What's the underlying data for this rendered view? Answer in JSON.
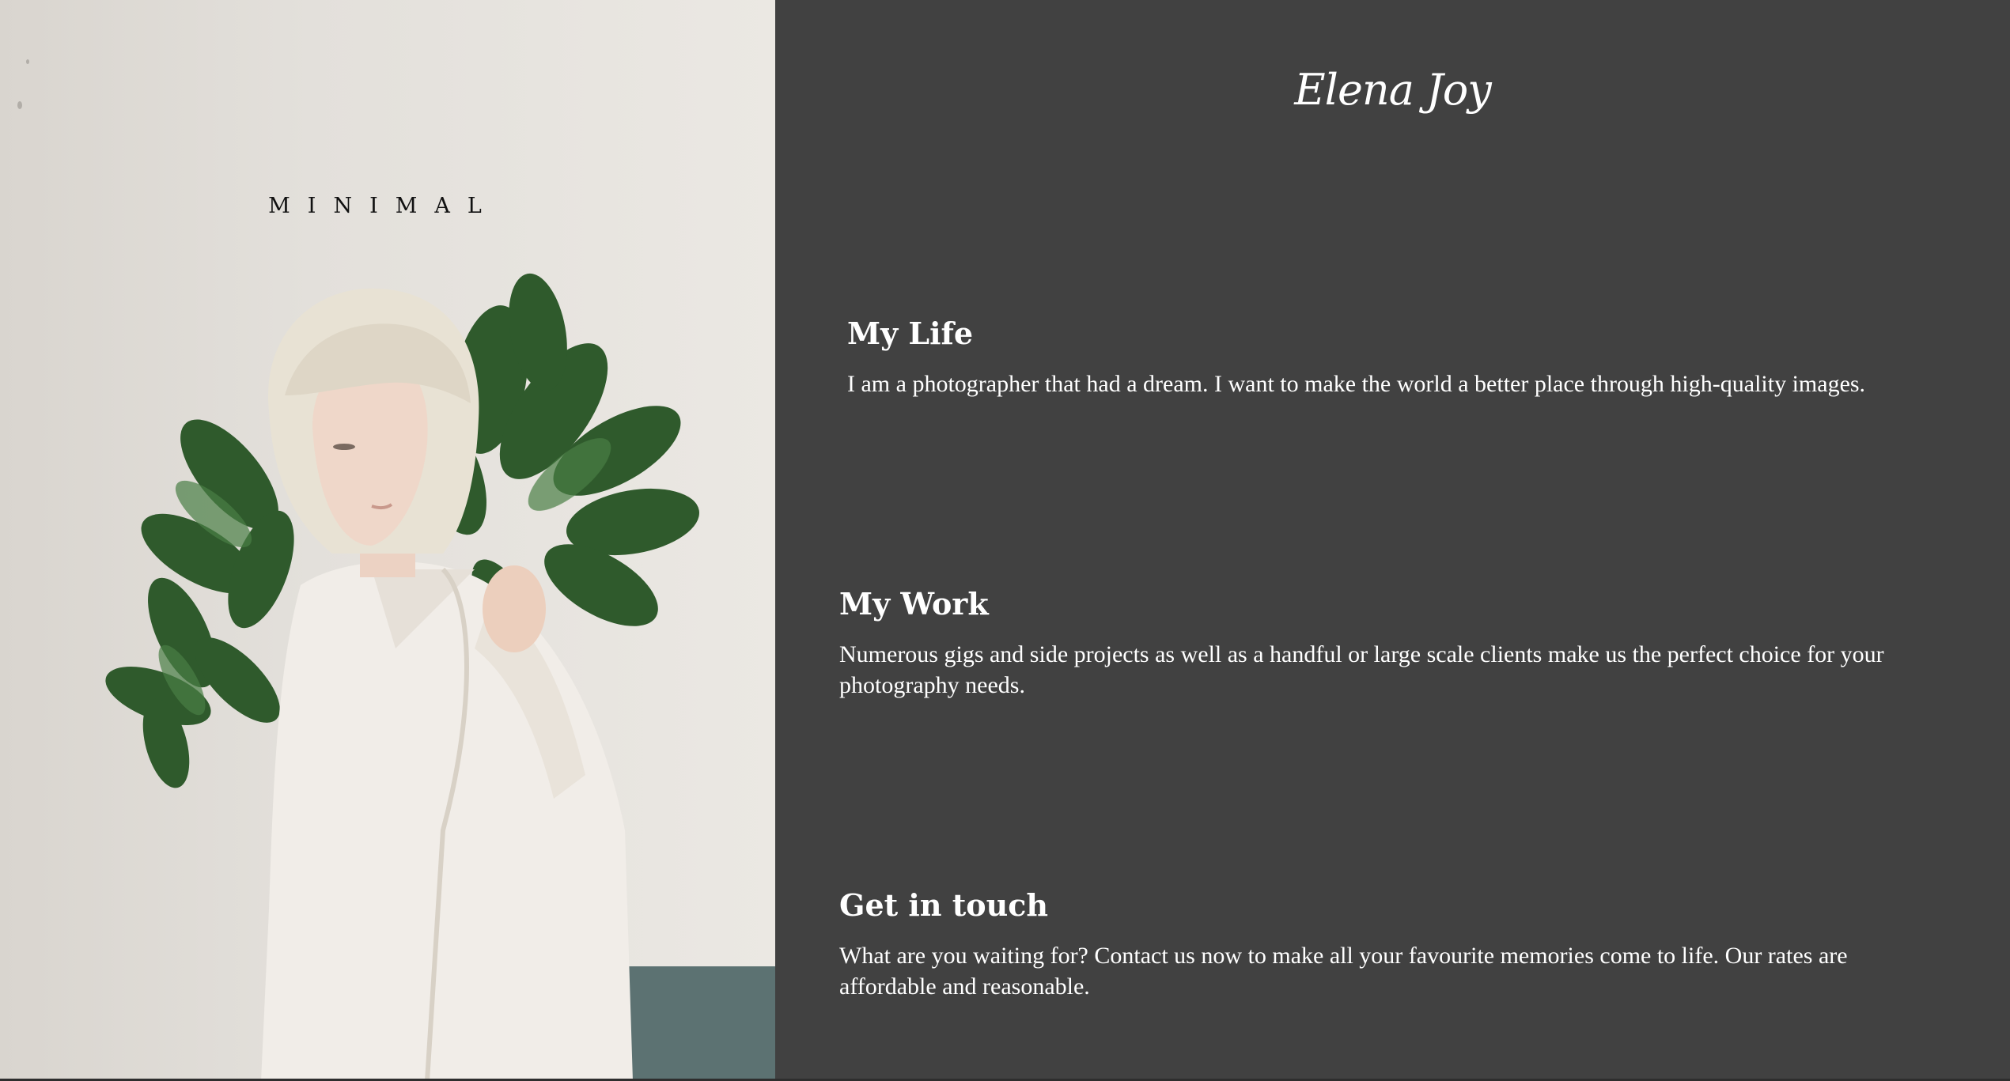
{
  "photo": {
    "overlay_text": "MINIMAL",
    "alt": "",
    "colors": {
      "wall": "#e3e0db",
      "hair": "#e8e2d4",
      "jacket": "#f1ede8",
      "leaves": "#2f5a2c",
      "stripe": "#5c7272"
    }
  },
  "header": {
    "brand": "Elena Joy"
  },
  "sections": [
    {
      "heading": "My Life",
      "body": "I am a photographer that had a dream. I want to make the world a better place through high-quality images."
    },
    {
      "heading": "My Work",
      "body": "Numerous gigs and side projects as well as a handful or large scale clients make us the perfect choice for your photography needs."
    },
    {
      "heading": "Get in touch",
      "body": "What are you waiting for? Contact us now to make all your favourite memories come to life. Our rates are affordable and reasonable."
    }
  ],
  "colors": {
    "background": "#414141",
    "text": "#ffffff"
  }
}
